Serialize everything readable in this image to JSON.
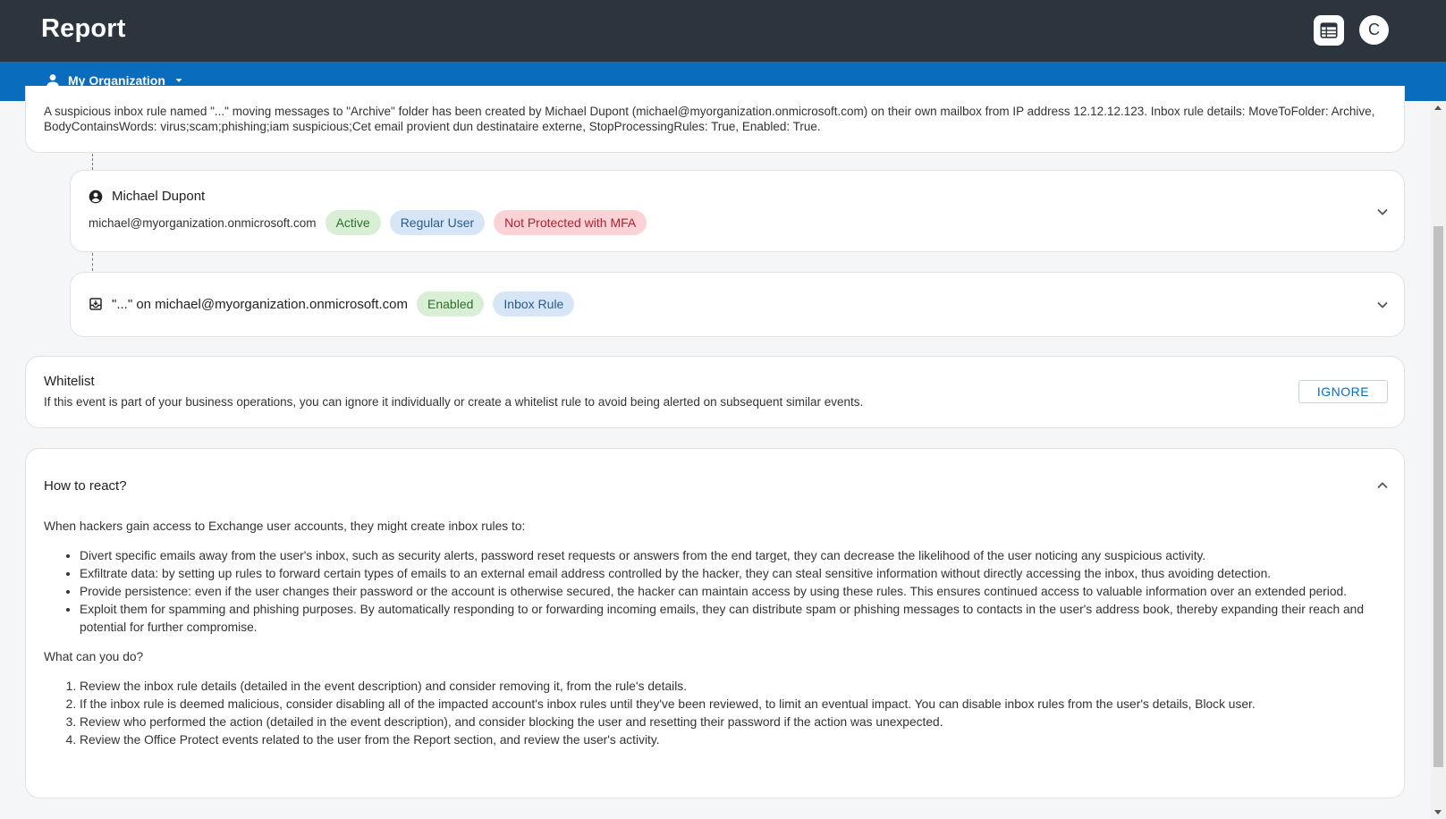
{
  "app": {
    "title": "Report",
    "avatar_initial": "C"
  },
  "org_selector": {
    "label": "My Organization"
  },
  "event": {
    "description": "A suspicious inbox rule named \"...\" moving messages to \"Archive\" folder has been created by Michael Dupont (michael@myorganization.onmicrosoft.com) on their own mailbox from IP address 12.12.12.123. Inbox rule details: MoveToFolder: Archive, BodyContainsWords: virus;scam;phishing;iam suspicious;Cet email provient dun destinataire externe, StopProcessingRules: True, Enabled: True."
  },
  "user_entity": {
    "name": "Michael Dupont",
    "email": "michael@myorganization.onmicrosoft.com",
    "badges": {
      "status": "Active",
      "role": "Regular User",
      "mfa": "Not Protected with MFA"
    }
  },
  "rule_entity": {
    "title": "\"...\" on michael@myorganization.onmicrosoft.com",
    "badges": {
      "state": "Enabled",
      "type": "Inbox Rule"
    }
  },
  "whitelist": {
    "heading": "Whitelist",
    "text": "If this event is part of your business operations, you can ignore it individually or create a whitelist rule to avoid being alerted on subsequent similar events.",
    "ignore_label": "IGNORE"
  },
  "how_to_react": {
    "heading": "How to react?",
    "intro": "When hackers gain access to Exchange user accounts, they might create inbox rules to:",
    "bullets": [
      "Divert specific emails away from the user's inbox, such as security alerts, password reset requests or answers from the end target, they can decrease the likelihood of the user noticing any suspicious activity.",
      "Exfiltrate data: by setting up rules to forward certain types of emails to an external email address controlled by the hacker, they can steal sensitive information without directly accessing the inbox, thus avoiding detection.",
      "Provide persistence: even if the user changes their password or the account is otherwise secured, the hacker can maintain access by using these rules. This ensures continued access to valuable information over an extended period.",
      "Exploit them for spamming and phishing purposes. By automatically responding to or forwarding incoming emails, they can distribute spam or phishing messages to contacts in the user's address book, thereby expanding their reach and potential for further compromise."
    ],
    "actions_intro": "What can you do?",
    "actions": [
      "Review the inbox rule details (detailed in the event description) and consider removing it, from the rule's details.",
      "If the inbox rule is deemed malicious, consider disabling all of the impacted account's inbox rules until they've been reviewed, to limit an eventual impact. You can disable inbox rules from the user's details, Block user.",
      "Review who performed the action (detailed in the event description), and consider blocking the user and resetting their password if the action was unexpected.",
      "Review the Office Protect events related to the user from the Report section, and review the user's activity."
    ]
  },
  "icons": {
    "calendar": "calendar-table-icon",
    "org": "person-icon",
    "dropdown": "caret-down-icon",
    "user": "account-circle-icon",
    "rule": "inbox-icon",
    "expand": "chevron-down-icon",
    "collapse": "chevron-up-icon"
  },
  "colors": {
    "topbar": "#2c353d",
    "orgbar": "#0a6cbd",
    "chip_green": "#d8efd5",
    "chip_blue": "#d6e6f6",
    "chip_red": "#fbd3d7"
  }
}
